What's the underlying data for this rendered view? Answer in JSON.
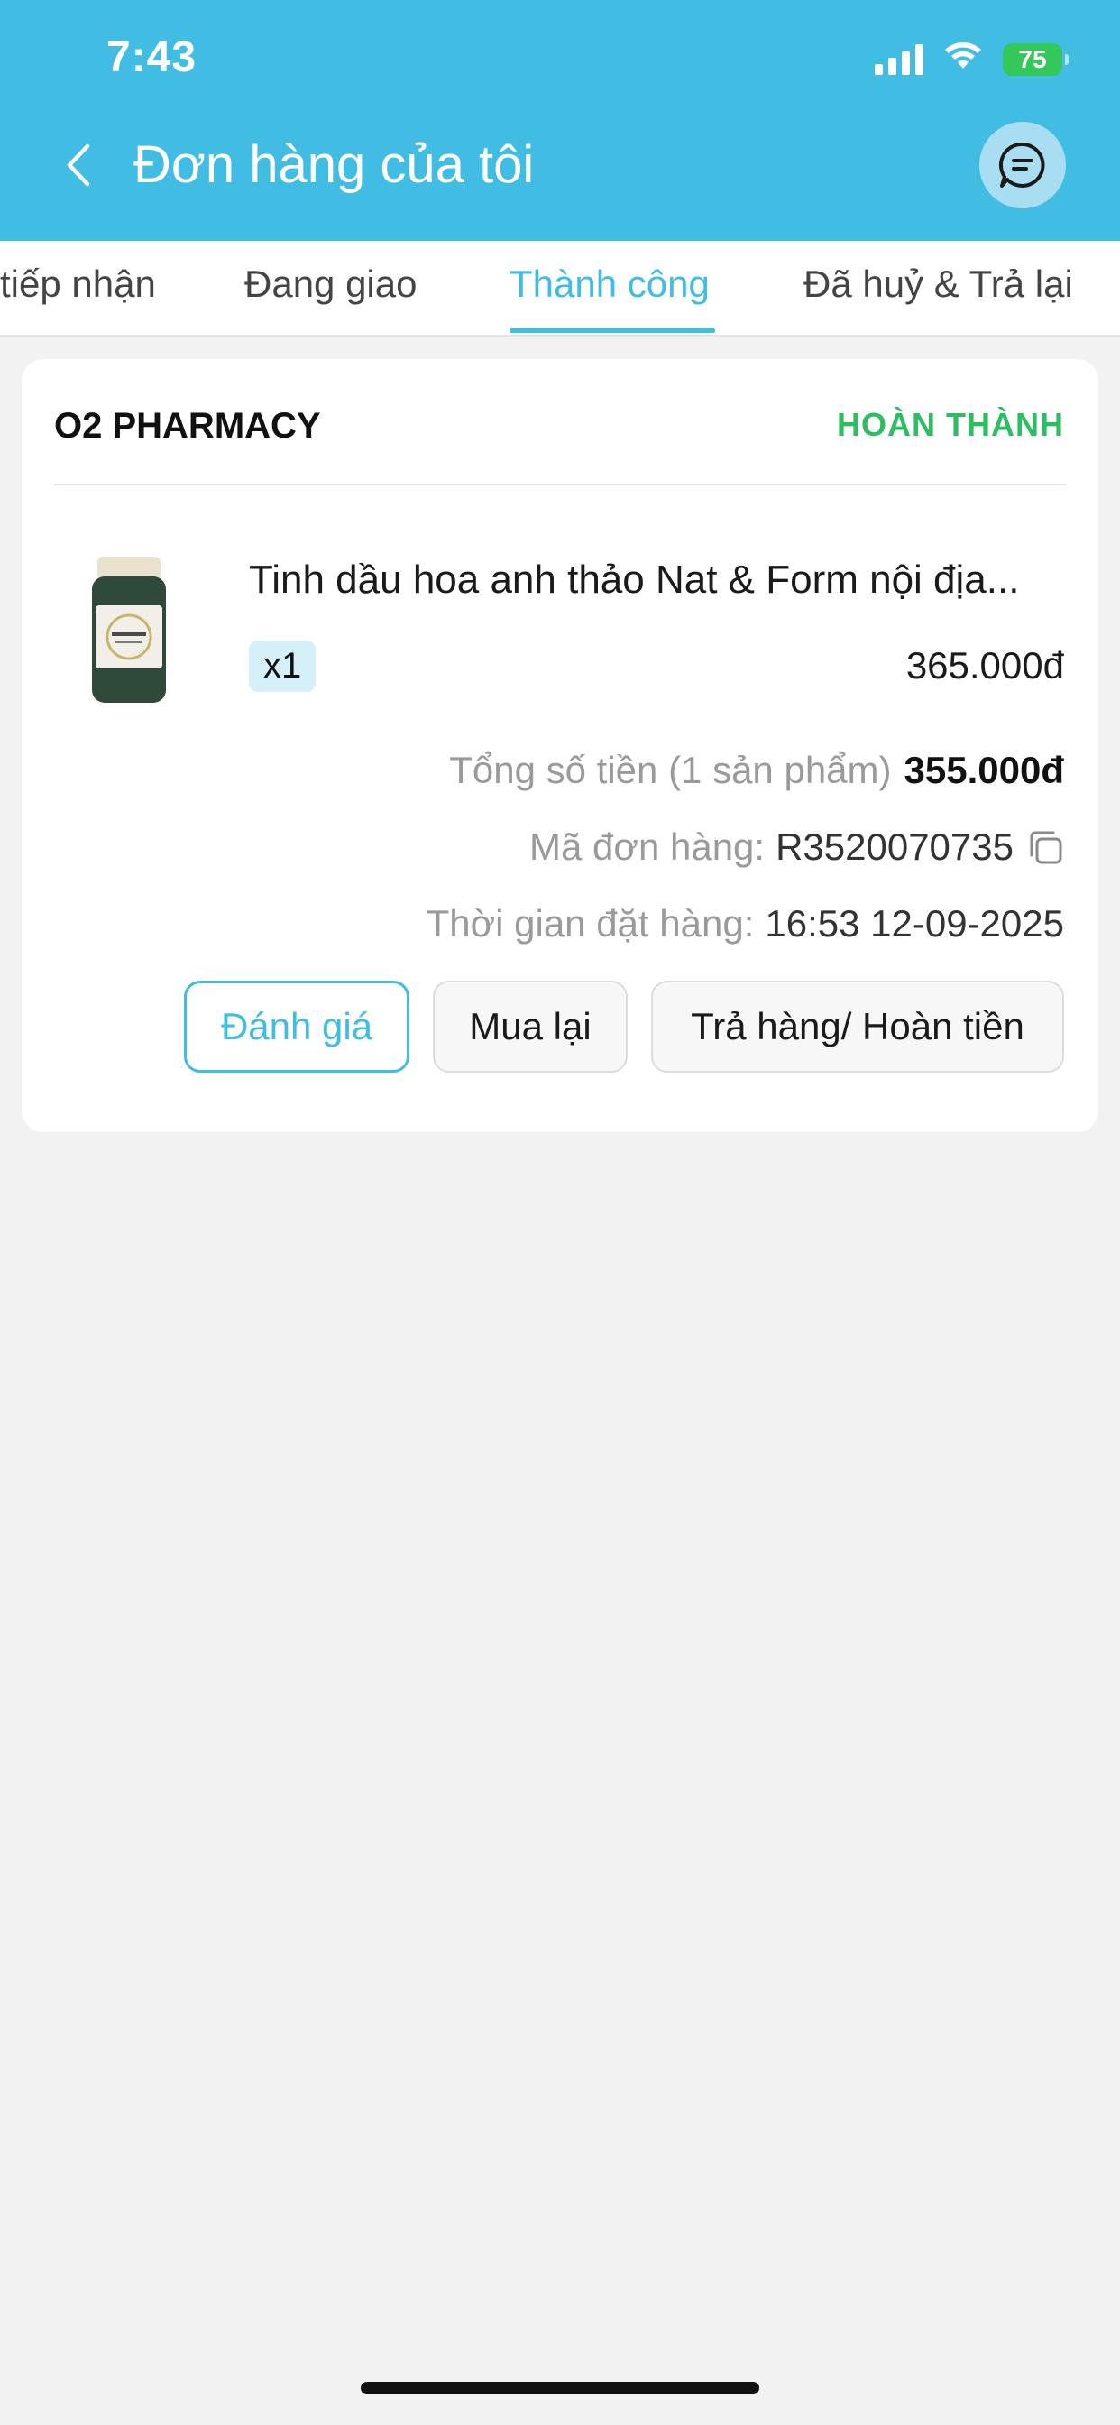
{
  "status_bar": {
    "time": "7:43",
    "battery": "75",
    "icons": [
      "signal-icon",
      "wifi-icon",
      "battery-charging-icon"
    ]
  },
  "header": {
    "title": "Đơn hàng của tôi",
    "back_icon": "chevron-left-icon",
    "chat_icon": "chat-bubble-icon"
  },
  "tabs": [
    {
      "label": "tiếp nhận",
      "active": false
    },
    {
      "label": "Đang giao",
      "active": false
    },
    {
      "label": "Thành công",
      "active": true
    },
    {
      "label": "Đã huỷ & Trả lại",
      "active": false
    }
  ],
  "order": {
    "store_name": "O2 PHARMACY",
    "status": "HOÀN THÀNH",
    "product": {
      "name": "Tinh dầu hoa anh thảo Nat & Form nội địa...",
      "quantity": "x1",
      "price": "365.000đ"
    },
    "total_label": "Tổng số tiền (1 sản phẩm)",
    "total_value": "355.000đ",
    "order_code_label": "Mã đơn hàng:",
    "order_code": "R3520070735",
    "order_time_label": "Thời gian đặt hàng:",
    "order_time": "16:53 12-09-2025",
    "actions": {
      "review": "Đánh giá",
      "rebuy": "Mua lại",
      "return_refund": "Trả hàng/ Hoàn tiền"
    }
  },
  "colors": {
    "primary": "#41bde4",
    "success": "#2ebd63",
    "background": "#f2f2f2"
  }
}
